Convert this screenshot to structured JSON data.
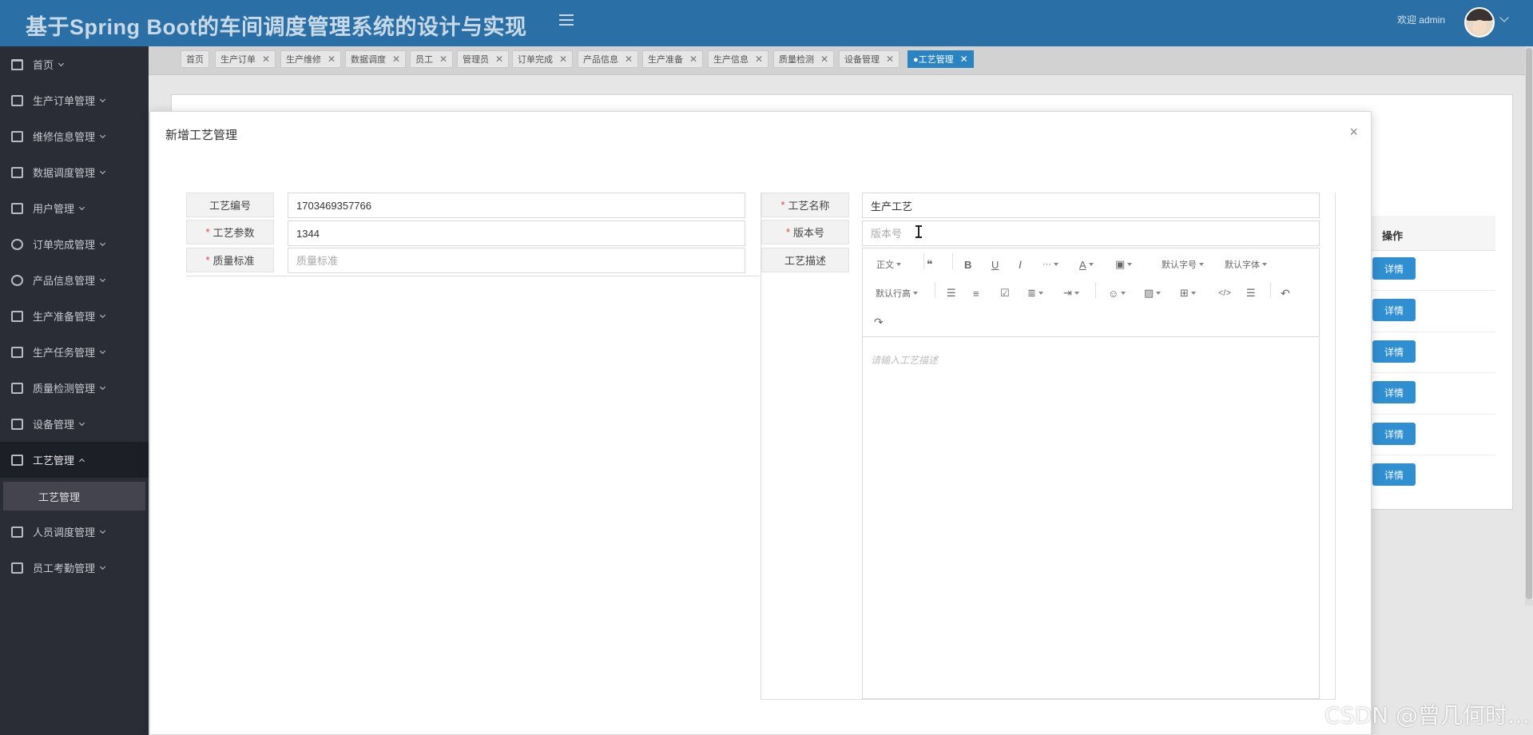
{
  "header": {
    "title": "基于Spring Boot的车间调度管理系统的设计与实现",
    "welcome": "欢迎 admin"
  },
  "sidebar": {
    "items": [
      {
        "label": "首页",
        "icon": "home-icon"
      },
      {
        "label": "生产订单管理",
        "icon": "order-icon"
      },
      {
        "label": "维修信息管理",
        "icon": "repair-icon"
      },
      {
        "label": "数据调度管理",
        "icon": "data-icon"
      },
      {
        "label": "用户管理",
        "icon": "briefcase-icon"
      },
      {
        "label": "订单完成管理",
        "icon": "chat-icon"
      },
      {
        "label": "产品信息管理",
        "icon": "product-icon"
      },
      {
        "label": "生产准备管理",
        "icon": "building-icon"
      },
      {
        "label": "生产任务管理",
        "icon": "briefcase-icon"
      },
      {
        "label": "质量检测管理",
        "icon": "quality-icon"
      },
      {
        "label": "设备管理",
        "icon": "device-icon"
      },
      {
        "label": "工艺管理",
        "icon": "wallet-icon"
      },
      {
        "label": "人员调度管理",
        "icon": "crop-icon"
      },
      {
        "label": "员工考勤管理",
        "icon": "chart-icon"
      }
    ],
    "open_item": "工艺管理",
    "sub_item": "工艺管理"
  },
  "tabs": [
    {
      "label": "首页",
      "closable": false
    },
    {
      "label": "生产订单",
      "closable": true
    },
    {
      "label": "生产维修",
      "closable": true
    },
    {
      "label": "数据调度",
      "closable": true
    },
    {
      "label": "员工",
      "closable": true
    },
    {
      "label": "管理员",
      "closable": true
    },
    {
      "label": "订单完成",
      "closable": true
    },
    {
      "label": "产品信息",
      "closable": true
    },
    {
      "label": "生产准备",
      "closable": true
    },
    {
      "label": "生产信息",
      "closable": true
    },
    {
      "label": "质量检测",
      "closable": true
    },
    {
      "label": "设备管理",
      "closable": true
    },
    {
      "label": "●工艺管理",
      "closable": true,
      "active": true
    }
  ],
  "background_table": {
    "column_header": "操作",
    "detail_label": "详情"
  },
  "modal": {
    "title": "新增工艺管理",
    "close_glyph": "×",
    "fields": {
      "process_no": {
        "label": "工艺编号",
        "value": "1703469357766",
        "required": false
      },
      "process_name": {
        "label": "工艺名称",
        "value": "生产工艺",
        "required": true
      },
      "process_params": {
        "label": "工艺参数",
        "value": "1344",
        "required": true
      },
      "version_no": {
        "label": "版本号",
        "placeholder": "版本号",
        "value": "",
        "required": true
      },
      "quality_std": {
        "label": "质量标准",
        "placeholder": "质量标准",
        "value": "",
        "required": true
      },
      "process_desc": {
        "label": "工艺描述",
        "placeholder": "请输入工艺描述"
      }
    },
    "editor_toolbar": {
      "paragraph": "正文",
      "font_size": "默认字号",
      "font_family": "默认字体",
      "line_height": "默认行高"
    }
  },
  "watermark": "CSDN @曾几何时…"
}
